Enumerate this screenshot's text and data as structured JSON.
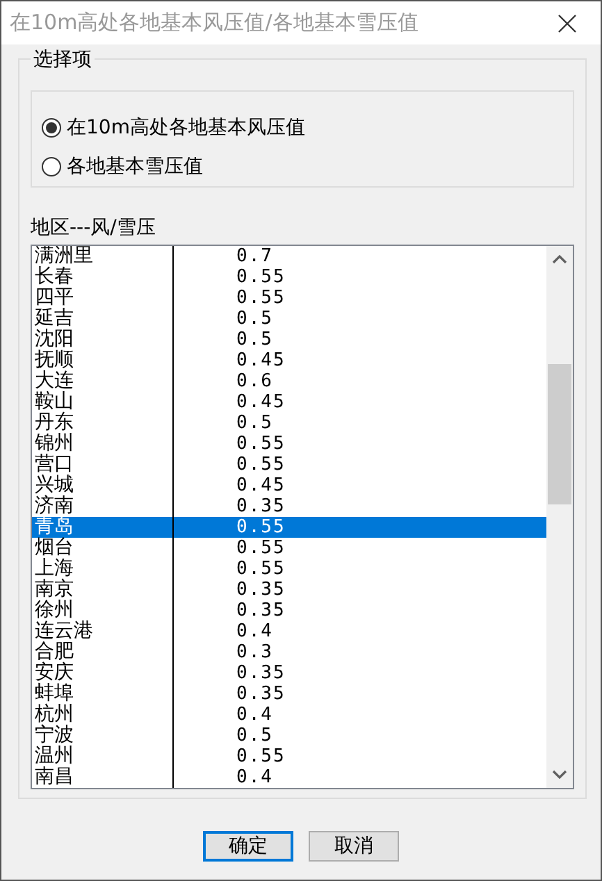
{
  "window": {
    "title": "在10m高处各地基本风压值/各地基本雪压值"
  },
  "options_group": {
    "title": "选择项",
    "options": [
      {
        "label": "在10m高处各地基本风压值",
        "selected": true
      },
      {
        "label": "各地基本雪压值",
        "selected": false
      }
    ]
  },
  "list": {
    "label": "地区---风/雪压",
    "rows": [
      {
        "region": "满洲里",
        "value": "0.7",
        "selected": false
      },
      {
        "region": "长春",
        "value": "0.55",
        "selected": false
      },
      {
        "region": "四平",
        "value": "0.55",
        "selected": false
      },
      {
        "region": "延吉",
        "value": "0.5",
        "selected": false
      },
      {
        "region": "沈阳",
        "value": "0.5",
        "selected": false
      },
      {
        "region": "抚顺",
        "value": "0.45",
        "selected": false
      },
      {
        "region": "大连",
        "value": "0.6",
        "selected": false
      },
      {
        "region": "鞍山",
        "value": "0.45",
        "selected": false
      },
      {
        "region": "丹东",
        "value": "0.5",
        "selected": false
      },
      {
        "region": "锦州",
        "value": "0.55",
        "selected": false
      },
      {
        "region": "营口",
        "value": "0.55",
        "selected": false
      },
      {
        "region": "兴城",
        "value": "0.45",
        "selected": false
      },
      {
        "region": "济南",
        "value": "0.35",
        "selected": false
      },
      {
        "region": "青岛",
        "value": "0.55",
        "selected": true
      },
      {
        "region": "烟台",
        "value": "0.55",
        "selected": false
      },
      {
        "region": "上海",
        "value": "0.55",
        "selected": false
      },
      {
        "region": "南京",
        "value": "0.35",
        "selected": false
      },
      {
        "region": "徐州",
        "value": "0.35",
        "selected": false
      },
      {
        "region": "连云港",
        "value": "0.4",
        "selected": false
      },
      {
        "region": "合肥",
        "value": "0.3",
        "selected": false
      },
      {
        "region": "安庆",
        "value": "0.35",
        "selected": false
      },
      {
        "region": "蚌埠",
        "value": "0.35",
        "selected": false
      },
      {
        "region": "杭州",
        "value": "0.4",
        "selected": false
      },
      {
        "region": "宁波",
        "value": "0.5",
        "selected": false
      },
      {
        "region": "温州",
        "value": "0.55",
        "selected": false
      },
      {
        "region": "南昌",
        "value": "0.4",
        "selected": false
      }
    ]
  },
  "buttons": [
    {
      "label": "确定",
      "default": true
    },
    {
      "label": "取消",
      "default": false
    }
  ]
}
